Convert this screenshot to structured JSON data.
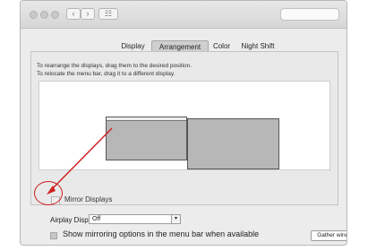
{
  "tabs": [
    {
      "label": "Display",
      "selected": false
    },
    {
      "label": "Arrangement",
      "selected": true
    },
    {
      "label": "Color",
      "selected": false
    },
    {
      "label": "Night Shift",
      "selected": false
    }
  ],
  "instructions": {
    "line1": "To rearrange the displays, drag them to the desired position.",
    "line2": "To relocate the menu bar, drag it to a different display."
  },
  "mirror": {
    "label": "Mirror Displays",
    "checked": false
  },
  "airplay": {
    "label": "Airplay Displays :",
    "value": "Off"
  },
  "show_mirroring": {
    "label": "Show mirroring options in the menu bar when available",
    "checked": true
  },
  "gather_button": "Gather windows",
  "colors": {
    "annotation": "#d11f1f",
    "selected_tab": "#cfcfcf",
    "display": "#b7b7b7"
  },
  "icons": [
    "back-icon",
    "forward-icon",
    "grid-icon",
    "select-arrow-icon"
  ]
}
